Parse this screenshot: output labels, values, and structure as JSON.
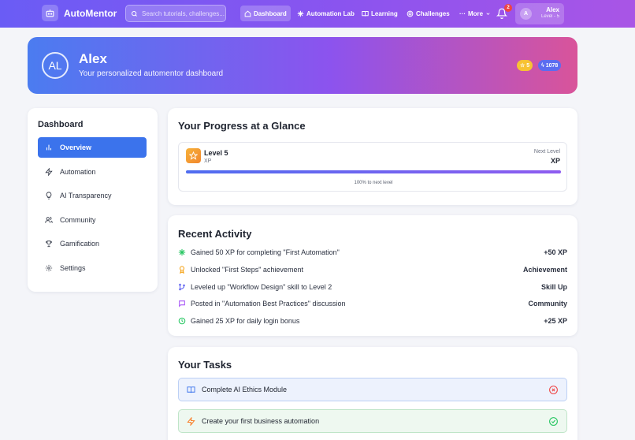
{
  "nav": {
    "brand": "AutoMentor",
    "search_placeholder": "Search tutorials, challenges...",
    "items": [
      {
        "label": "Dashboard",
        "icon": "home-icon",
        "active": true
      },
      {
        "label": "Automation Lab",
        "icon": "sparkle-icon"
      },
      {
        "label": "Learning",
        "icon": "book-icon"
      },
      {
        "label": "Challenges",
        "icon": "target-icon"
      },
      {
        "label": "More",
        "icon": "dots-icon"
      }
    ],
    "notifications": "2",
    "user": {
      "initial": "A",
      "name": "Alex",
      "level": "Level - 5"
    }
  },
  "hero": {
    "initials": "AL",
    "name": "Alex",
    "subtitle": "Your personalized automentor dashboard",
    "stars": "5",
    "xp": "1078"
  },
  "sidebar": {
    "title": "Dashboard",
    "items": [
      {
        "label": "Overview",
        "icon": "bar-chart-icon",
        "active": true
      },
      {
        "label": "Automation",
        "icon": "lightning-icon"
      },
      {
        "label": "AI Transparency",
        "icon": "lightbulb-icon"
      },
      {
        "label": "Community",
        "icon": "users-icon"
      },
      {
        "label": "Gamification",
        "icon": "trophy-icon"
      },
      {
        "label": "Settings",
        "icon": "gear-icon"
      }
    ]
  },
  "progress": {
    "title": "Your Progress at a Glance",
    "level": "Level 5",
    "sub": "XP",
    "next_label": "Next Level",
    "next_value": "XP",
    "fill": 1.0,
    "caption": "100% to next level"
  },
  "activity": {
    "title": "Recent Activity",
    "items": [
      {
        "text": "Gained 50 XP for completing \"First Automation\"",
        "value": "+50 XP",
        "icon": "sparkle-icon",
        "color": "#22c55e"
      },
      {
        "text": "Unlocked \"First Steps\" achievement",
        "value": "Achievement",
        "icon": "award-icon",
        "color": "#f59e0b"
      },
      {
        "text": "Leveled up \"Workflow Design\" skill to Level 2",
        "value": "Skill Up",
        "icon": "branch-icon",
        "color": "#6366f1"
      },
      {
        "text": "Posted in \"Automation Best Practices\" discussion",
        "value": "Community",
        "icon": "message-icon",
        "color": "#a855f7"
      },
      {
        "text": "Gained 25 XP for daily login bonus",
        "value": "+25 XP",
        "icon": "clock-icon",
        "color": "#22c55e"
      }
    ]
  },
  "tasks": {
    "title": "Your Tasks",
    "items": [
      {
        "label": "Complete AI Ethics Module",
        "icon": "book-open-icon",
        "status": "x-circle-icon"
      },
      {
        "label": "Create your first business automation",
        "icon": "lightning-icon",
        "status": "check-circle-icon"
      }
    ]
  },
  "colors": {
    "accent": "#3b73ec",
    "danger": "#ef4444",
    "success": "#22c55e"
  }
}
